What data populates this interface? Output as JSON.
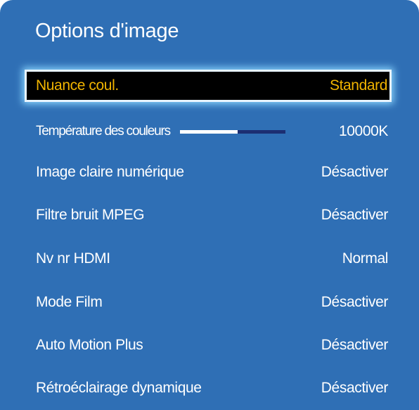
{
  "menu": {
    "title": "Options d'image",
    "items": [
      {
        "label": "Nuance coul.",
        "value": "Standard",
        "selected": true
      },
      {
        "label": "Température des couleurs",
        "value": "10000K",
        "slider_level": 0.55
      },
      {
        "label": "Image claire numérique",
        "value": "Désactiver"
      },
      {
        "label": "Filtre bruit MPEG",
        "value": "Désactiver"
      },
      {
        "label": "Nv nr HDMI",
        "value": "Normal"
      },
      {
        "label": "Mode Film",
        "value": "Désactiver"
      },
      {
        "label": "Auto Motion Plus",
        "value": "Désactiver"
      },
      {
        "label": "Rétroéclairage dynamique",
        "value": "Désactiver"
      }
    ]
  },
  "colors": {
    "panel_background": "#2f6fb5",
    "selected_text": "#f0b400",
    "slider_track": "#1c2e72",
    "slider_fill": "#ffffff"
  }
}
